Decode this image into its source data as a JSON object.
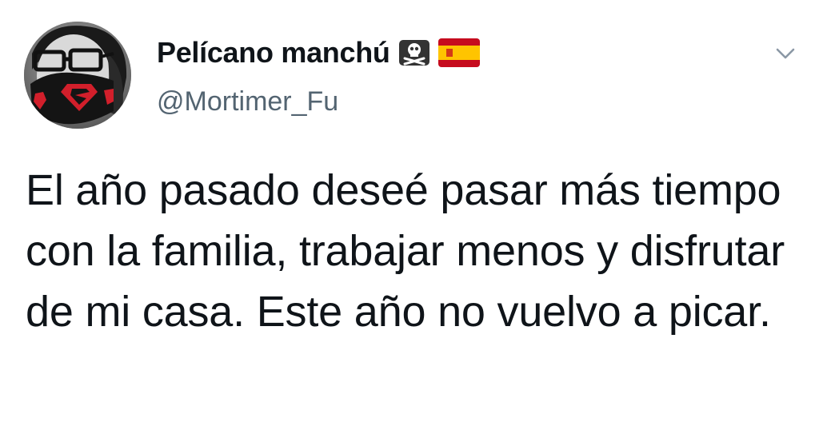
{
  "tweet": {
    "author": {
      "display_name": "Pelícano manchú",
      "handle": "@Mortimer_Fu",
      "name_emojis": [
        "skull-and-crossbones-icon",
        "spain-flag-icon"
      ]
    },
    "text": "El año pasado deseé pasar más tiempo con la familia, trabajar menos y disfrutar de mi casa. Este año no vuelvo a picar."
  },
  "colors": {
    "text_primary": "#0f1419",
    "text_secondary": "#536471",
    "background": "#ffffff",
    "mask_red": "#d21f2b",
    "flag_red": "#c60b1e",
    "flag_yellow": "#ffc400"
  }
}
